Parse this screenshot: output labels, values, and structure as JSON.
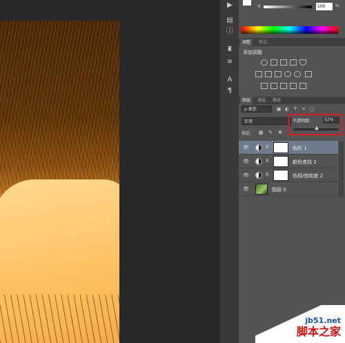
{
  "color_panel": {
    "k_label": "K",
    "k_value": "100",
    "k_unit": "%"
  },
  "adjustments": {
    "tabs": [
      "调整",
      "样式"
    ],
    "title": "添加调整"
  },
  "layers": {
    "tabs": [
      "图层",
      "通道",
      "路径"
    ],
    "filter_label": "ρ 类型",
    "blend_mode": "正常",
    "opacity_label": "不透明度:",
    "opacity_value": "52%",
    "opacity_fraction": 0.52,
    "lock_label": "锁定:",
    "items": [
      {
        "name": "色阶 1",
        "type": "adjustment",
        "selected": true
      },
      {
        "name": "颜色查找 2",
        "type": "adjustment",
        "selected": false
      },
      {
        "name": "色相/饱和度 2",
        "type": "adjustment",
        "selected": false
      },
      {
        "name": "图层 0",
        "type": "image",
        "selected": false
      }
    ]
  },
  "watermark": {
    "site": "jb51.net",
    "name": "脚本之家"
  },
  "icons": {
    "eye": "eye-icon",
    "chain": "chain-link-icon"
  }
}
